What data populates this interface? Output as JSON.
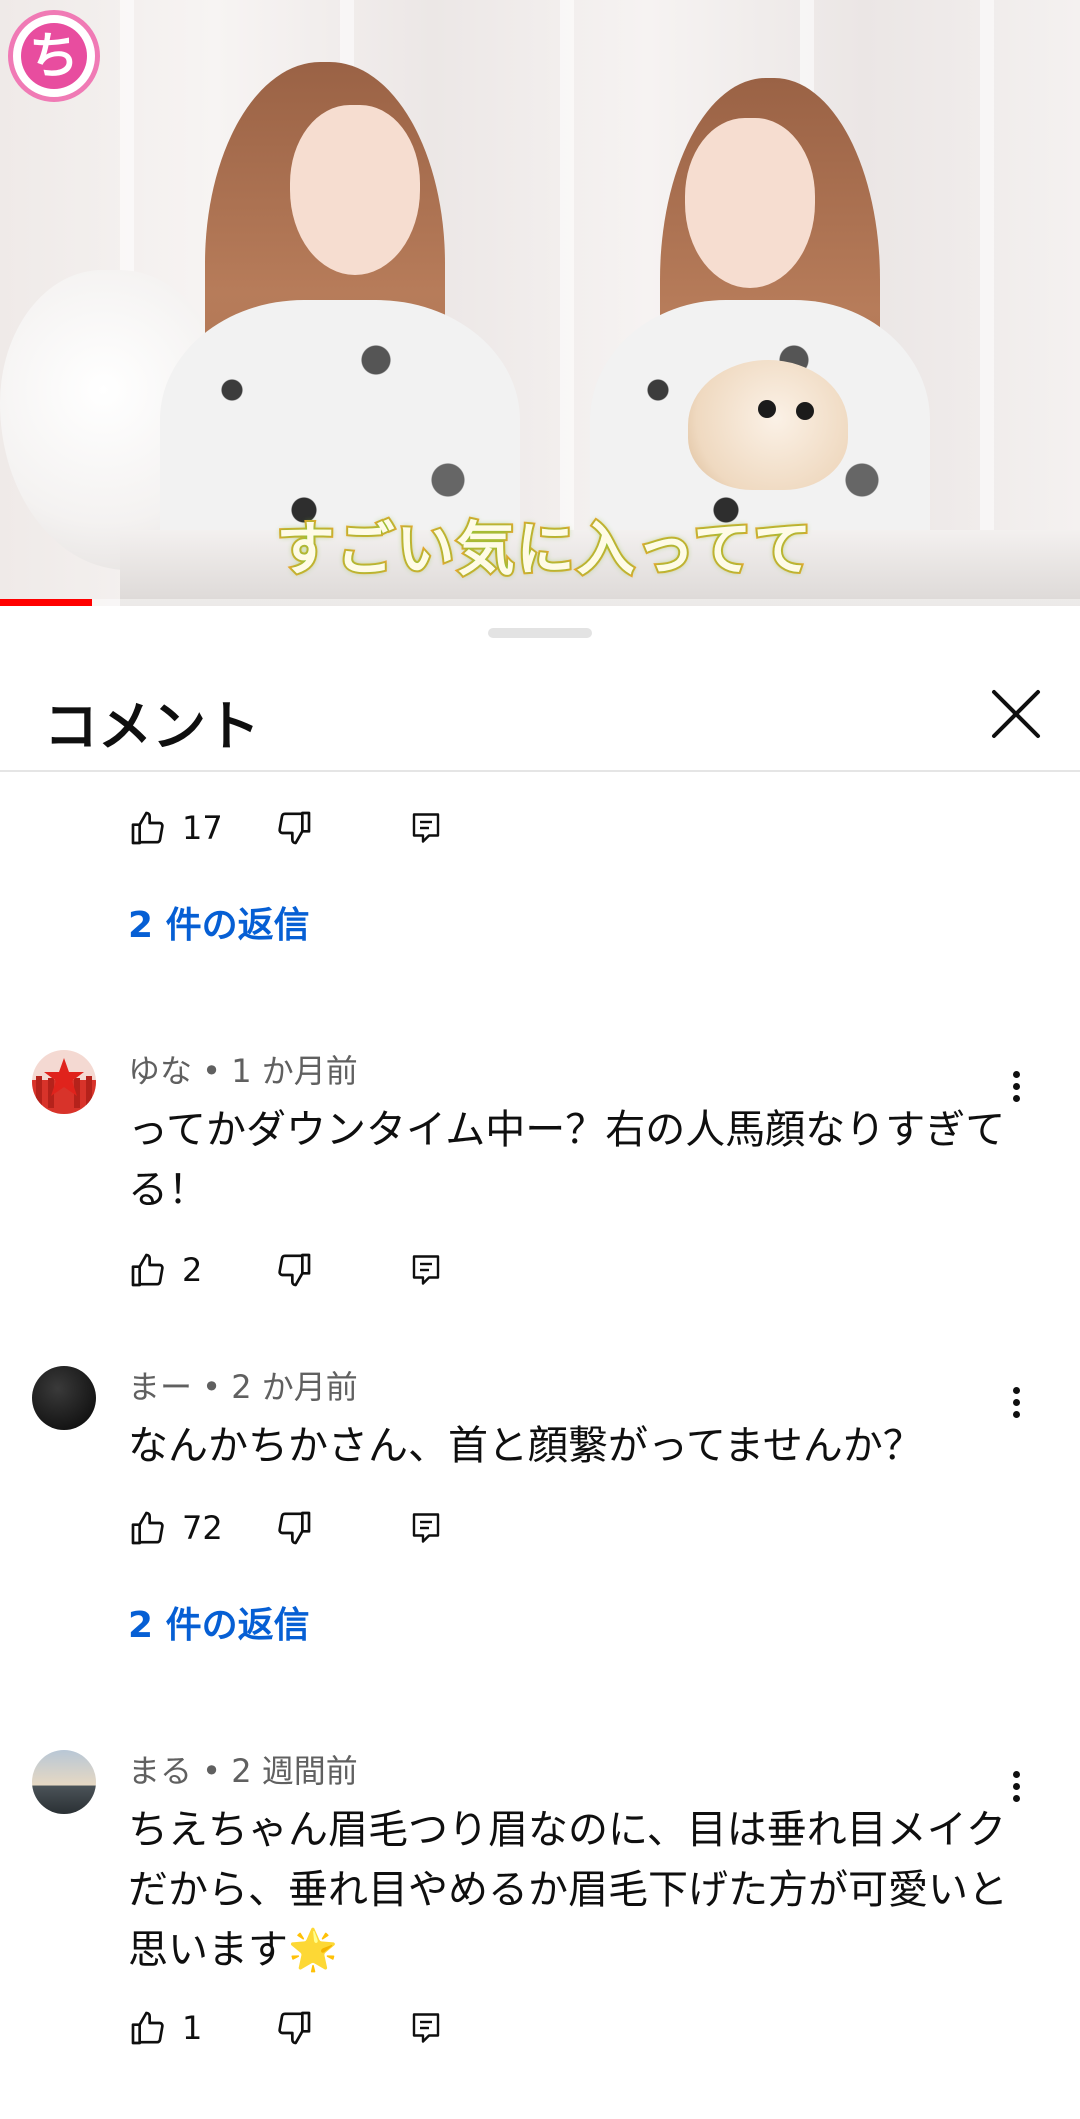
{
  "video": {
    "caption": "すごい気に入ってて",
    "channel_logo_char": "ち",
    "progress_fraction": 0.085,
    "progress_color": "#ff0000"
  },
  "sheet": {
    "title": "コメント",
    "close_icon": "close-icon"
  },
  "first_thread": {
    "likes": "17",
    "replies_label": "2 件の返信"
  },
  "comments": [
    {
      "meta": "ゆな • 1 か月前",
      "text": "ってかダウンタイム中ー？右の人馬顔なりすぎてる！",
      "likes": "2"
    },
    {
      "meta": "まー • 2 か月前",
      "text": "なんかちかさん、首と顔繋がってませんか？",
      "likes": "72",
      "replies_label": "2 件の返信"
    },
    {
      "meta": "まる • 2 週間前",
      "text": "ちえちゃん眉毛つり眉なのに、目は垂れ目メイクだから、垂れ目やめるか眉毛下げた方が可愛いと思います🌟",
      "likes": "1"
    }
  ],
  "colors": {
    "link_blue": "#065fd4",
    "meta_gray": "#606060",
    "text": "#0f0f0f"
  }
}
